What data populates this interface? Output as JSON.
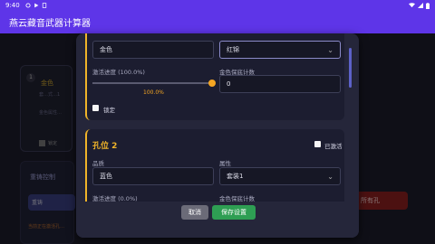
{
  "status_bar": {
    "time": "9:40"
  },
  "app_bar": {
    "title": "燕云藏音武器计算器"
  },
  "background": {
    "card": {
      "number": "1",
      "title": "金色",
      "line1": "套…式…1",
      "line2": "金色属性…",
      "lock_label": "锁定"
    },
    "section": {
      "title": "重铸控制",
      "button": "重铸",
      "note": "当前正在激活孔…"
    },
    "right_button": "所有孔"
  },
  "dialog": {
    "slot1": {
      "quality_value": "金色",
      "attribute_value": "红锦",
      "progress_label": "激活进度 (100.0%)",
      "progress_value": "100.0%",
      "progress_fraction": 1.0,
      "gold_count_label": "金色保底计数",
      "gold_count_value": "0",
      "lock_label": "锁定"
    },
    "slot2": {
      "title": "孔位 2",
      "activated_label": "已激活",
      "quality_label": "品质",
      "quality_value": "蓝色",
      "attribute_label": "属性",
      "attribute_value": "套装1",
      "progress_label": "激活进度 (0.0%)",
      "gold_count_label": "金色保底计数"
    },
    "buttons": {
      "cancel": "取消",
      "save": "保存设置"
    }
  }
}
